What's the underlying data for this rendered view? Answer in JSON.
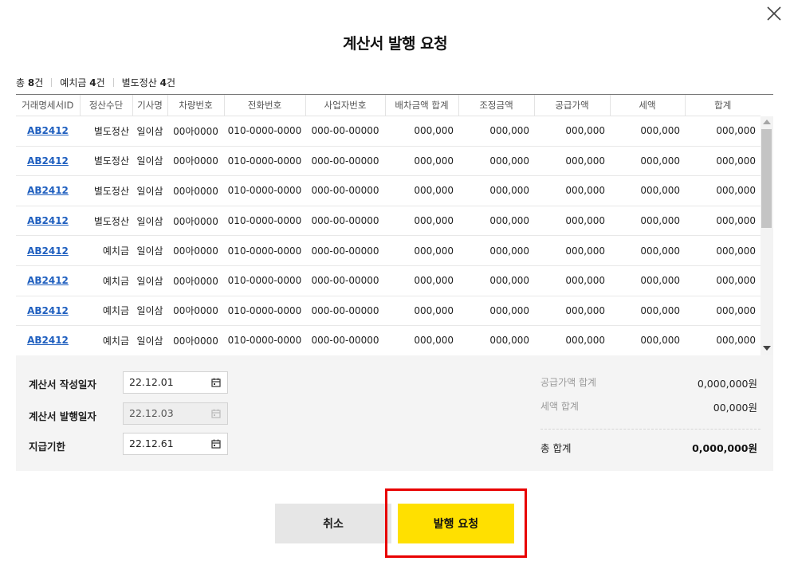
{
  "dialog": {
    "title": "계산서 발행 요청",
    "close_icon": "close-icon"
  },
  "summary": {
    "total_label": "총",
    "total_count": "8",
    "total_unit": "건",
    "deposit_label": "예치금",
    "deposit_count": "4",
    "deposit_unit": "건",
    "separate_label": "별도정산",
    "separate_count": "4",
    "separate_unit": "건"
  },
  "table": {
    "headers": [
      "거래명세서ID",
      "정산수단",
      "기사명",
      "차량번호",
      "전화번호",
      "사업자번호",
      "배차금액 합계",
      "조정금액",
      "공급가액",
      "세액",
      "합계"
    ],
    "rows": [
      [
        "AB2412",
        "별도정산",
        "일이삼",
        "00아0000",
        "010-0000-0000",
        "000-00-00000",
        "000,000",
        "000,000",
        "000,000",
        "000,000",
        "000,000"
      ],
      [
        "AB2412",
        "별도정산",
        "일이삼",
        "00아0000",
        "010-0000-0000",
        "000-00-00000",
        "000,000",
        "000,000",
        "000,000",
        "000,000",
        "000,000"
      ],
      [
        "AB2412",
        "별도정산",
        "일이삼",
        "00아0000",
        "010-0000-0000",
        "000-00-00000",
        "000,000",
        "000,000",
        "000,000",
        "000,000",
        "000,000"
      ],
      [
        "AB2412",
        "별도정산",
        "일이삼",
        "00아0000",
        "010-0000-0000",
        "000-00-00000",
        "000,000",
        "000,000",
        "000,000",
        "000,000",
        "000,000"
      ],
      [
        "AB2412",
        "예치금",
        "일이삼",
        "00아0000",
        "010-0000-0000",
        "000-00-00000",
        "000,000",
        "000,000",
        "000,000",
        "000,000",
        "000,000"
      ],
      [
        "AB2412",
        "예치금",
        "일이삼",
        "00아0000",
        "010-0000-0000",
        "000-00-00000",
        "000,000",
        "000,000",
        "000,000",
        "000,000",
        "000,000"
      ],
      [
        "AB2412",
        "예치금",
        "일이삼",
        "00아0000",
        "010-0000-0000",
        "000-00-00000",
        "000,000",
        "000,000",
        "000,000",
        "000,000",
        "000,000"
      ],
      [
        "AB2412",
        "예치금",
        "일이삼",
        "00아0000",
        "010-0000-0000",
        "000-00-00000",
        "000,000",
        "000,000",
        "000,000",
        "000,000",
        "000,000"
      ]
    ]
  },
  "form": {
    "write_date_label": "계산서 작성일자",
    "write_date_value": "22.12.01",
    "issue_date_label": "계산서 발행일자",
    "issue_date_value": "22.12.03",
    "due_label": "지급기한",
    "due_value": "22.12.61"
  },
  "totals": {
    "supply_label": "공급가액 합계",
    "supply_value": "0,000,000원",
    "tax_label": "세액 합계",
    "tax_value": "00,000원",
    "grand_label": "총 합계",
    "grand_value": "0,000,000원"
  },
  "buttons": {
    "cancel_label": "취소",
    "issue_label": "발행 요청"
  },
  "colors": {
    "accent_yellow": "#ffe000",
    "link_blue": "#1f5fbf",
    "highlight_red": "#e80000"
  }
}
